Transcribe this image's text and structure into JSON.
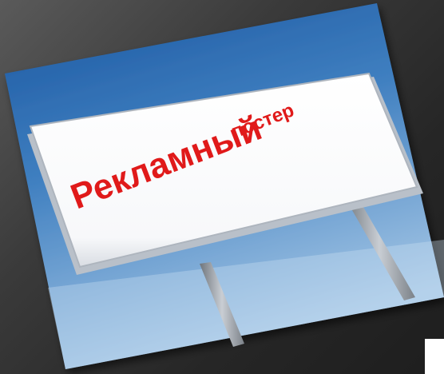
{
  "image": {
    "sign_text_big": "Рекламный",
    "sign_text_small": "постер",
    "colors": {
      "background_dark": "#262626",
      "sky_top": "#1f5fa8",
      "sky_bottom": "#9fc3e4",
      "sign_face": "#ffffff",
      "sign_text": "#e01a1a",
      "poles": "#8a8f96"
    }
  }
}
